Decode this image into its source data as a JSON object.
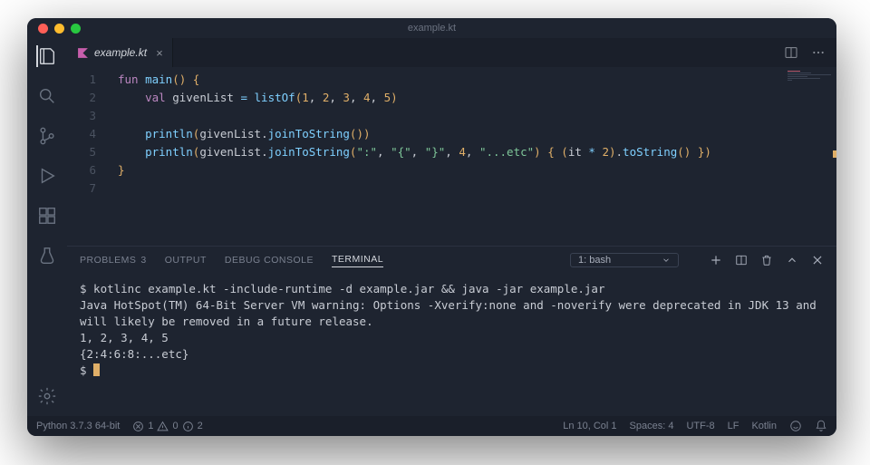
{
  "window": {
    "title": "example.kt"
  },
  "tab": {
    "filename": "example.kt"
  },
  "editor": {
    "line_numbers": [
      "1",
      "2",
      "3",
      "4",
      "5",
      "6",
      "7"
    ],
    "lines": {
      "l1": {
        "kw1": "fun",
        "fn": "main",
        "paren": "()",
        "brace": " {"
      },
      "l2": {
        "kw1": "val",
        "var": "givenList",
        "op": " = ",
        "fn": "listOf",
        "paren_o": "(",
        "n1": "1",
        "c": ", ",
        "n2": "2",
        "n3": "3",
        "n4": "4",
        "n5": "5",
        "paren_c": ")"
      },
      "l4": {
        "fn": "println",
        "paren_o": "(",
        "var": "givenList",
        "dot": ".",
        "call": "joinToString",
        "paren2_o": "(",
        "paren2_c": ")",
        "paren_c": ")"
      },
      "l5": {
        "fn": "println",
        "paren_o": "(",
        "var": "givenList",
        "dot": ".",
        "call": "joinToString",
        "paren2_o": "(",
        "s1": "\":\"",
        "s2": "\"{\"",
        "s3": "\"}\"",
        "n": "4",
        "s4": "\"...etc\"",
        "paren2_c": ")",
        "lambda_o": " { ",
        "paren3_o": "(",
        "it": "it",
        "mul": " * ",
        "two": "2",
        "paren3_c": ")",
        "dot2": ".",
        "call2": "toString",
        "paren4": "()",
        "lambda_c": " }",
        "paren_c": ")"
      },
      "l6": {
        "brace": "}"
      }
    }
  },
  "panel": {
    "tabs": {
      "problems": "PROBLEMS",
      "problems_count": "3",
      "output": "OUTPUT",
      "debug": "DEBUG CONSOLE",
      "terminal": "TERMINAL"
    },
    "terminal_name": "1: bash",
    "terminal_lines": {
      "cmd": "$ kotlinc example.kt -include-runtime -d example.jar && java -jar example.jar",
      "warn": "Java HotSpot(TM) 64-Bit Server VM warning: Options -Xverify:none and -noverify were deprecated in JDK 13 and will likely be removed in a future release.",
      "out1": "1, 2, 3, 4, 5",
      "out2": "{2:4:6:8:...etc}",
      "prompt": "$ "
    }
  },
  "status": {
    "python": "Python 3.7.3 64-bit",
    "err_count": "1",
    "warn_count": "0",
    "info_count": "2",
    "lncol": "Ln 10, Col 1",
    "spaces": "Spaces: 4",
    "encoding": "UTF-8",
    "eol": "LF",
    "lang": "Kotlin"
  }
}
